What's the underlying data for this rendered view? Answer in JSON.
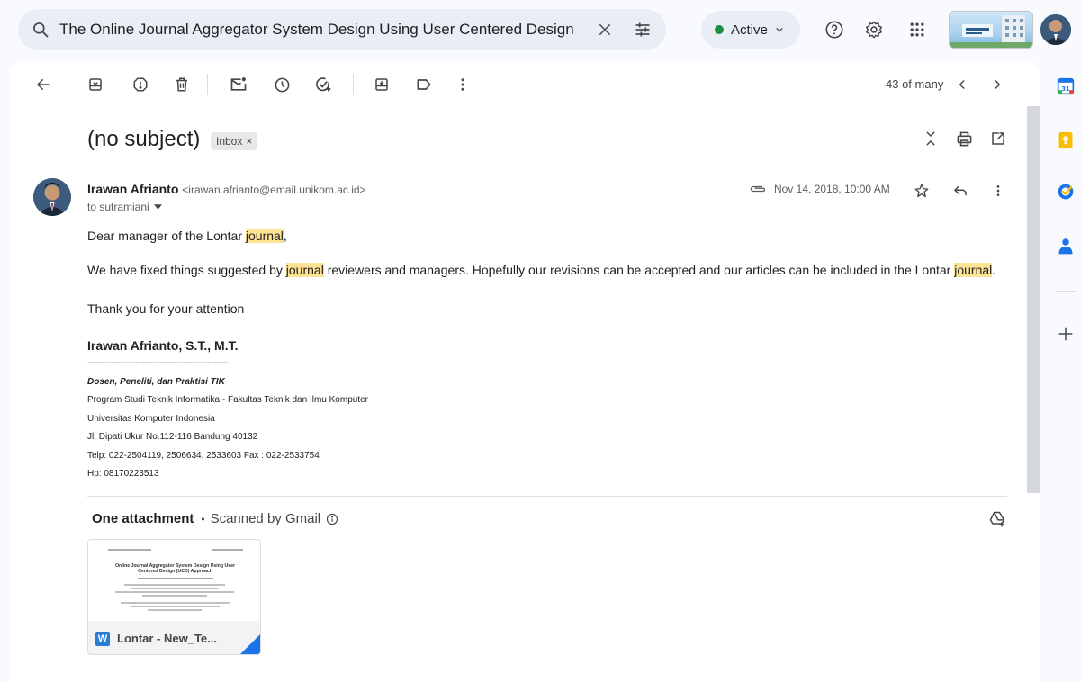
{
  "search": {
    "query": "The Online Journal Aggregator System Design Using User Centered Design"
  },
  "status": {
    "label": "Active",
    "color": "#1e8e3e"
  },
  "header_icons": [
    "search-icon",
    "close-icon",
    "filter-options-icon",
    "help-icon",
    "settings-icon",
    "apps-grid-icon"
  ],
  "toolbar": {
    "pager": "43 of many",
    "icons": [
      "back-arrow-icon",
      "archive-icon",
      "report-spam-icon",
      "delete-icon",
      "mark-unread-icon",
      "snooze-icon",
      "add-task-icon",
      "move-to-icon",
      "label-icon",
      "more-vert-icon",
      "prev-icon",
      "next-icon"
    ]
  },
  "email": {
    "subject": "(no subject)",
    "label_chip": "Inbox",
    "label_close": "×",
    "sender_name": "Irawan Afrianto",
    "sender_email": "<irawan.afrianto@email.unikom.ac.id>",
    "to": "to sutramiani",
    "date": "Nov 14, 2018, 10:00 AM",
    "greeting_pre": "Dear manager of the Lontar ",
    "greeting_mark": "journal",
    "greeting_post": ",",
    "para1_a": "We have fixed things suggested by ",
    "para1_mark1": "journal",
    "para1_b": " reviewers and managers. Hopefully our revisions can be accepted and our articles can be included in the Lontar ",
    "para1_mark2": "journal",
    "para1_c": ".",
    "thanks": "Thank you for your attention",
    "signature": {
      "name": "Irawan Afrianto, S.T., M.T.",
      "rule": "-----------------------------------------------",
      "title": "Dosen, Peneliti, dan Praktisi TIK",
      "line1": "Program Studi Teknik Informatika - Fakultas Teknik dan Ilmu Komputer",
      "line2": "Universitas Komputer Indonesia",
      "line3": "Jl. Dipati Ukur No.112-116 Bandung 40132",
      "line4": "Telp: 022-2504119, 2506634, 2533603 Fax : 022-2533754",
      "line5": "Hp: 08170223513"
    }
  },
  "attachments": {
    "heading": "One attachment",
    "separator": "•",
    "scanned": "Scanned by Gmail",
    "file_name": "Lontar - New_Te...",
    "file_type_letter": "W",
    "preview_title": "Online Journal Aggregator System Design Using User Centered Design (UCD) Approach"
  },
  "side_panel": [
    "calendar-icon",
    "keep-icon",
    "tasks-icon",
    "contacts-icon",
    "add-icon"
  ],
  "colors": {
    "highlight": "#fde293",
    "accent": "#1a73e8",
    "word": "#2b7cd3"
  }
}
